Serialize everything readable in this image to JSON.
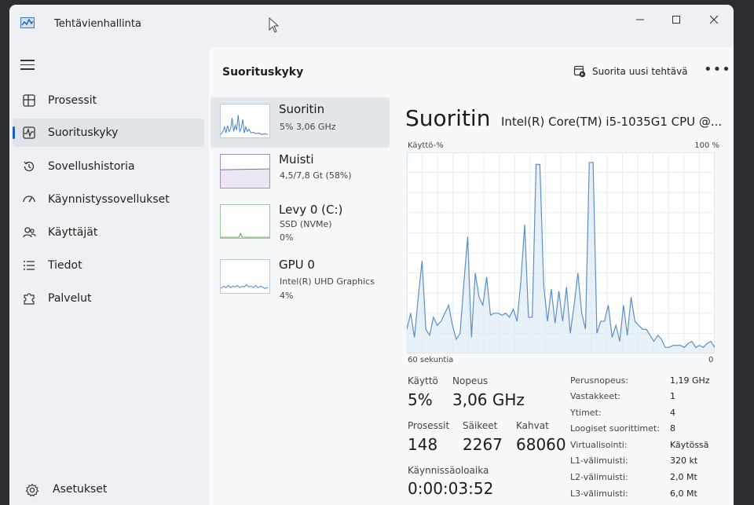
{
  "window": {
    "title": "Tehtävienhallinta"
  },
  "nav": {
    "items": [
      {
        "label": "Prosessit",
        "icon": "grid-icon"
      },
      {
        "label": "Suorituskyky",
        "icon": "pulse-icon"
      },
      {
        "label": "Sovellushistoria",
        "icon": "history-icon"
      },
      {
        "label": "Käynnistyssovellukset",
        "icon": "gauge-icon"
      },
      {
        "label": "Käyttäjät",
        "icon": "users-icon"
      },
      {
        "label": "Tiedot",
        "icon": "list-icon"
      },
      {
        "label": "Palvelut",
        "icon": "puzzle-icon"
      }
    ],
    "active_index": 1,
    "settings_label": "Asetukset"
  },
  "header": {
    "title": "Suorituskyky",
    "run_task_label": "Suorita uusi tehtävä",
    "more_label": "•••"
  },
  "perf_list": [
    {
      "name": "Suoritin",
      "sub1": "5%  3,06 GHz",
      "sub2": ""
    },
    {
      "name": "Muisti",
      "sub1": "4,5/7,8 Gt (58%)",
      "sub2": ""
    },
    {
      "name": "Levy 0 (C:)",
      "sub1": "SSD (NVMe)",
      "sub2": "0%"
    },
    {
      "name": "GPU 0",
      "sub1": "Intel(R) UHD Graphics",
      "sub2": "4%"
    }
  ],
  "detail": {
    "title": "Suoritin",
    "model": "Intel(R) Core(TM) i5-1035G1 CPU @...",
    "y_label": "Käyttö-%",
    "y_max_label": "100 %",
    "x_left_label": "60 sekuntia",
    "x_right_label": "0",
    "stats": {
      "usage_label": "Käyttö",
      "usage_value": "5%",
      "speed_label": "Nopeus",
      "speed_value": "3,06 GHz",
      "processes_label": "Prosessit",
      "processes_value": "148",
      "threads_label": "Säikeet",
      "threads_value": "2267",
      "handles_label": "Kahvat",
      "handles_value": "68060",
      "uptime_label": "Käynnissäoloaika",
      "uptime_value": "0:00:03:52"
    },
    "specs": [
      {
        "k": "Perusnopeus:",
        "v": "1,19 GHz"
      },
      {
        "k": "Vastakkeet:",
        "v": "1"
      },
      {
        "k": "Ytimet:",
        "v": "4"
      },
      {
        "k": "Loogiset suorittimet:",
        "v": "8"
      },
      {
        "k": "Virtualisointi:",
        "v": "Käytössä"
      },
      {
        "k": "L1-välimuisti:",
        "v": "320 kt"
      },
      {
        "k": "L2-välimuisti:",
        "v": "2,0 Mt"
      },
      {
        "k": "L3-välimuisti:",
        "v": "6,0 Mt"
      }
    ]
  },
  "colors": {
    "accent": "#1a5fb4",
    "graph_line": "#5b8fc7",
    "graph_fill": "#dbe7f3"
  },
  "chart_data": {
    "type": "line",
    "ylim": [
      0,
      100
    ],
    "values": [
      12,
      20,
      8,
      28,
      46,
      12,
      9,
      18,
      14,
      16,
      20,
      24,
      14,
      7,
      10,
      35,
      58,
      8,
      40,
      28,
      24,
      38,
      19,
      20,
      20,
      19,
      20,
      18,
      22,
      16,
      36,
      64,
      18,
      18,
      94,
      94,
      34,
      16,
      32,
      15,
      31,
      16,
      33,
      10,
      24,
      40,
      20,
      12,
      95,
      95,
      10,
      16,
      16,
      24,
      8,
      14,
      6,
      24,
      9,
      28,
      16,
      14,
      12,
      12,
      9,
      6,
      9,
      7,
      3,
      3,
      4,
      4,
      4,
      3,
      5,
      6,
      3,
      4,
      3,
      5,
      6,
      3
    ]
  }
}
